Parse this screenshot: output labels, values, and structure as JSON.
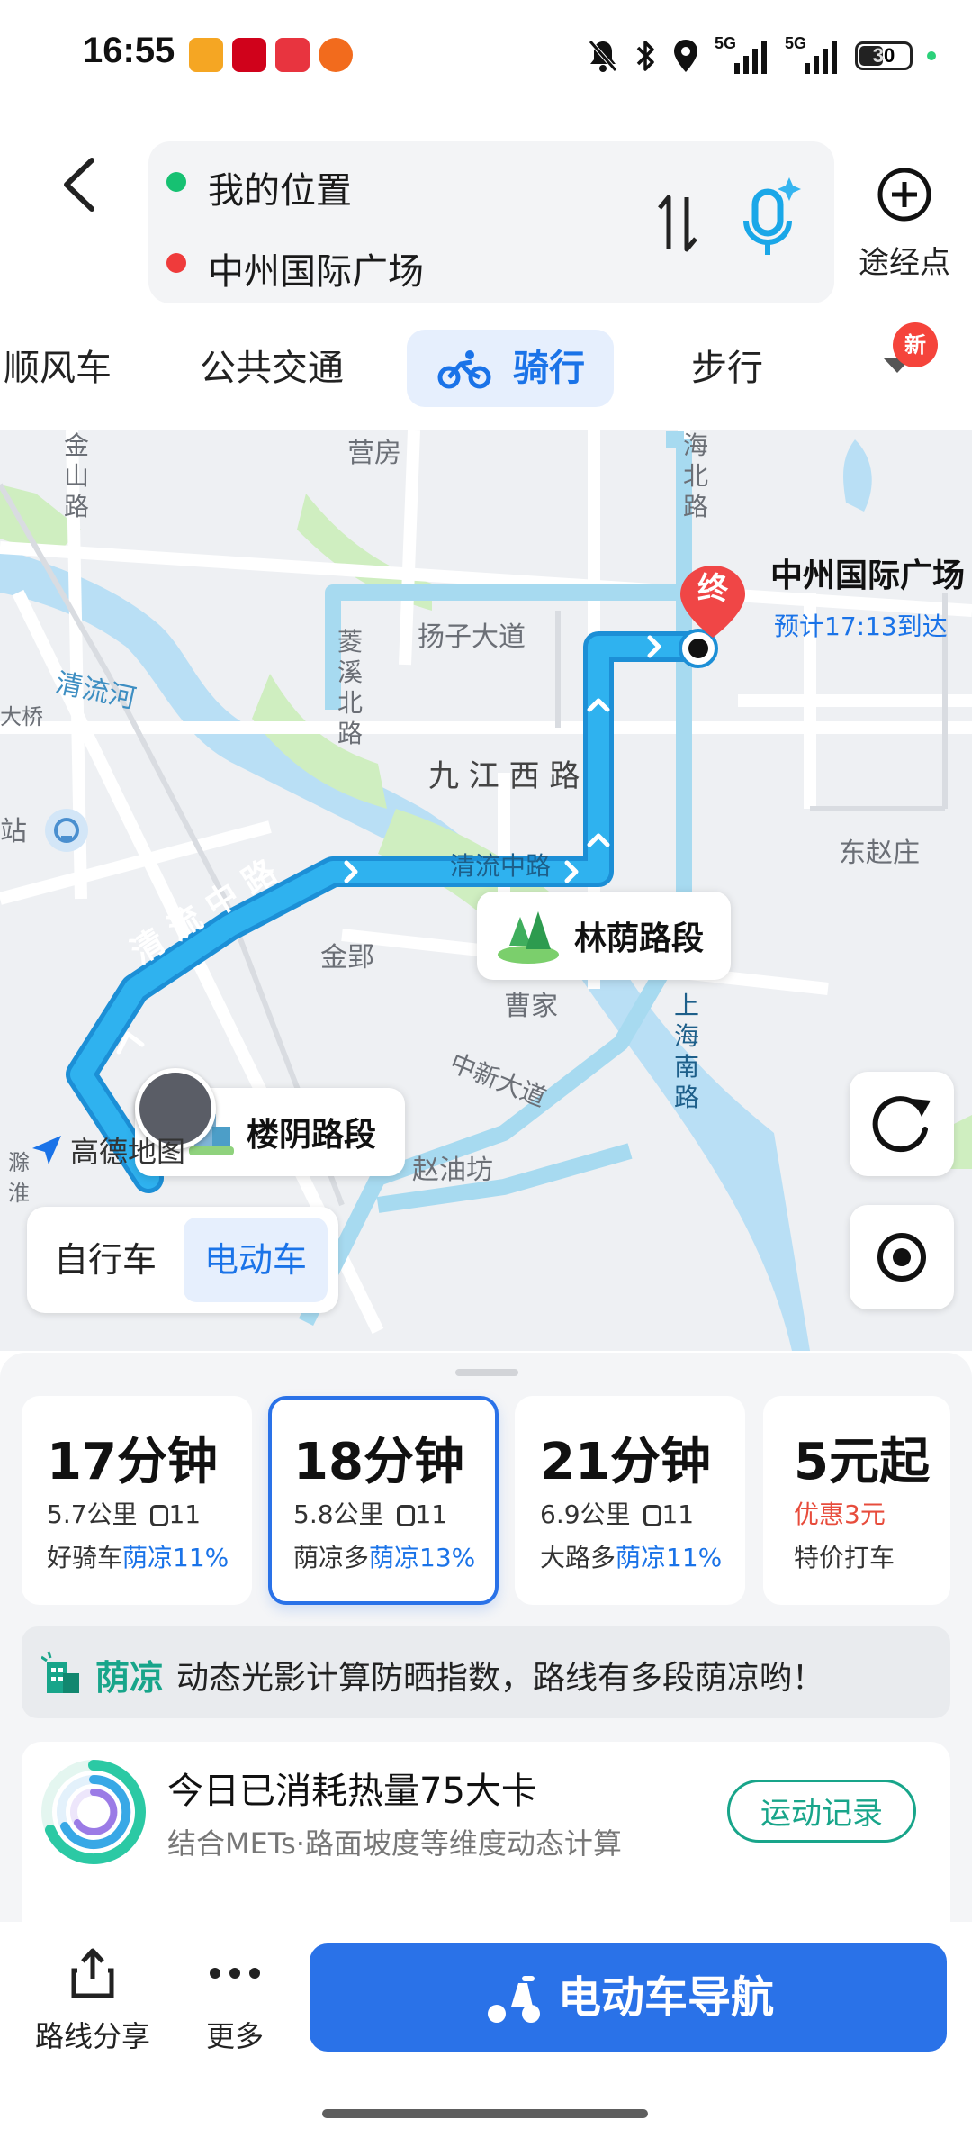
{
  "status_bar": {
    "time": "16:55",
    "battery": "30",
    "network_1": "5G",
    "network_2": "5G"
  },
  "route": {
    "origin": "我的位置",
    "destination": "中州国际广场",
    "waypoint_label": "途经点"
  },
  "tabs": {
    "partial": "顺风车",
    "transit": "公共交通",
    "cycling": "骑行",
    "walking": "步行",
    "new_badge": "新"
  },
  "map": {
    "labels": {
      "yingfang": "营房",
      "yangzi": "扬子大道",
      "qingliu_he": "清流河",
      "jiujiang": "九 江 西 路",
      "qingliu_zhong": "清流中路",
      "qingliu_zhong_big": "清 流 中 路",
      "jinying": "金郢",
      "caojia": "曹家",
      "zhongxin": "中新大道",
      "zhaoyoufang": "赵油坊",
      "dongzhaozhuang": "东赵庄",
      "daqiao": "大桥",
      "zhan": "站",
      "jinshan": "金山路",
      "lingxi": "菱溪北路",
      "haibei": "海北路",
      "shanghai_nan": "上海南路",
      "chuxian": "滁淮"
    },
    "destination_name": "中州国际广场",
    "eta": "预计17:13到达",
    "end_marker": "终",
    "segment_shade": "林荫路段",
    "segment_building": "楼阴路段",
    "logo_text": "高德地图",
    "vehicle_options": [
      "自行车",
      "电动车"
    ],
    "vehicle_selected": "电动车"
  },
  "options": [
    {
      "time": "17分钟",
      "distance": "5.7公里",
      "lights": "11",
      "tag_plain": "好骑车",
      "tag_accent": "荫凉11%"
    },
    {
      "time": "18分钟",
      "distance": "5.8公里",
      "lights": "11",
      "tag_plain": "荫凉多",
      "tag_accent": "荫凉13%"
    },
    {
      "time": "21分钟",
      "distance": "6.9公里",
      "lights": "11",
      "tag_plain": "大路多",
      "tag_accent": "荫凉11%"
    },
    {
      "time": "5元起",
      "discount": "优惠3元",
      "tag_plain": "特价打车"
    }
  ],
  "selected_option": 1,
  "shade_banner": {
    "title": "荫凉",
    "text": "动态光影计算防晒指数，路线有多段荫凉哟！"
  },
  "calorie": {
    "title": "今日已消耗热量75大卡",
    "subtitle": "结合METs·路面坡度等维度动态计算",
    "button": "运动记录"
  },
  "bottom_bar": {
    "share": "路线分享",
    "more": "更多",
    "navigate": "电动车导航"
  },
  "colors": {
    "accent": "#1a73e8",
    "route": "#29a6e8",
    "teal": "#18a58a",
    "red": "#e74c3c"
  }
}
